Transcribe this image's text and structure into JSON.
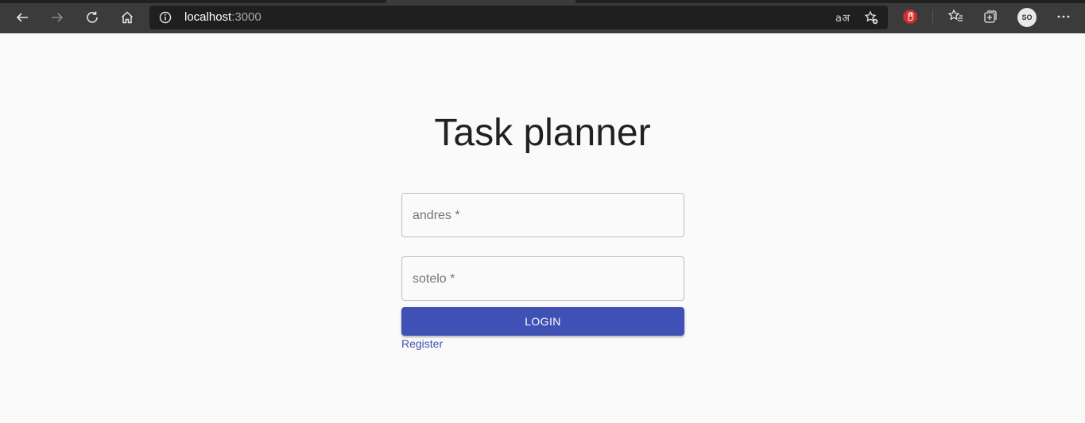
{
  "browser": {
    "address": {
      "host": "localhost",
      "port": ":3000"
    },
    "translate_glyph": "aअ",
    "profile_initials": "SO",
    "icons": {
      "back": "back-arrow-icon",
      "forward": "forward-arrow-icon",
      "refresh": "refresh-icon",
      "home": "home-icon",
      "info": "info-icon",
      "translate": "translate-icon",
      "add_favorite": "add-favorite-icon",
      "extension": "adblock-extension-icon",
      "favorites": "favorites-icon",
      "collections": "collections-icon",
      "more": "more-options-icon"
    },
    "colors": {
      "toolbar": "#3b3b3b",
      "address_bar": "#1f1f1f",
      "extension_red": "#d32f2f"
    }
  },
  "page": {
    "title": "Task planner",
    "username_field": {
      "label": "andres *"
    },
    "password_field": {
      "label": "sotelo *"
    },
    "login_button": "LOGIN",
    "register_link": "Register",
    "colors": {
      "primary": "#3f51b5",
      "background": "#fafafa"
    }
  }
}
